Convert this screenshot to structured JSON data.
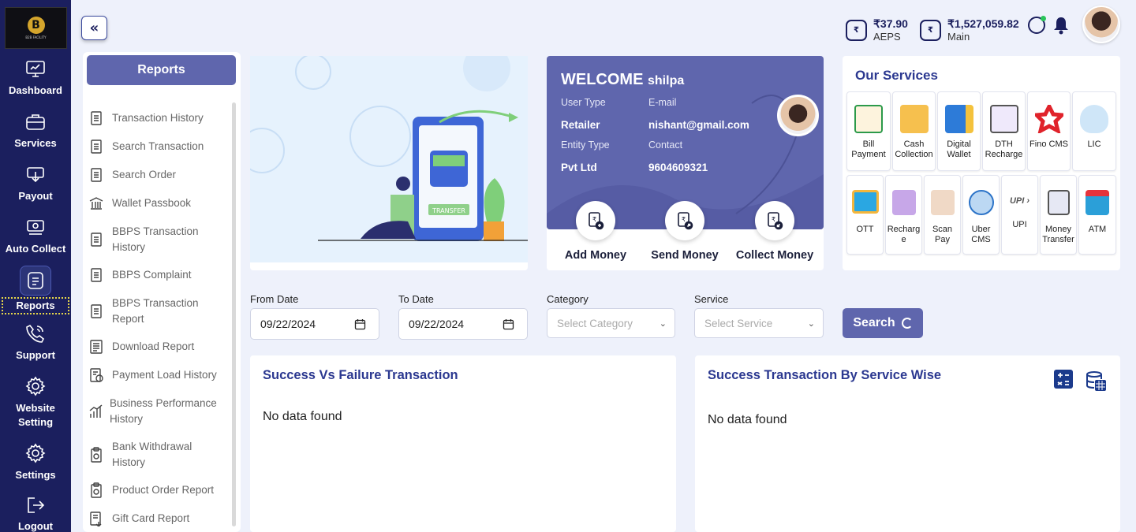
{
  "brand": {
    "logo_text": "B2B FACILITY",
    "logo_letter": "B"
  },
  "nav": [
    {
      "label": "Dashboard",
      "icon": "monitor-icon"
    },
    {
      "label": "Services",
      "icon": "briefcase-icon"
    },
    {
      "label": "Payout",
      "icon": "payout-icon"
    },
    {
      "label": "Auto Collect",
      "icon": "auto-collect-icon"
    },
    {
      "label": "Reports",
      "icon": "report-icon",
      "active": true
    },
    {
      "label": "Support",
      "icon": "phone-icon"
    },
    {
      "label": "Website Setting",
      "icon": "gear-icon"
    },
    {
      "label": "Settings",
      "icon": "gear-icon"
    },
    {
      "label": "Logout",
      "icon": "logout-icon"
    }
  ],
  "header": {
    "collapse_symbol": "«",
    "wallets": [
      {
        "amount": "₹37.90",
        "name": "AEPS"
      },
      {
        "amount": "₹1,527,059.82",
        "name": "Main"
      }
    ]
  },
  "reports": {
    "title": "Reports",
    "items": [
      "Transaction History",
      "Search Transaction",
      "Search Order",
      "Wallet Passbook",
      "BBPS Transaction History",
      "BBPS Complaint",
      "BBPS Transaction Report",
      "Download Report",
      "Payment Load History",
      "Business Performance History",
      "Bank Withdrawal History",
      "Product Order Report",
      "Gift Card Report"
    ]
  },
  "banner": {
    "tag": "TRANSFER"
  },
  "welcome": {
    "greeting": "WELCOME",
    "name": "shilpa",
    "user_type_label": "User Type",
    "user_type": "Retailer",
    "email_label": "E-mail",
    "email": "nishant@gmail.com",
    "entity_type_label": "Entity Type",
    "entity_type": "Pvt Ltd",
    "contact_label": "Contact",
    "contact": "9604609321",
    "actions": [
      "Add Money",
      "Send Money",
      "Collect Money"
    ]
  },
  "services": {
    "title": "Our Services",
    "row1": [
      "Bill Payment",
      "Cash Collection",
      "Digital Wallet",
      "DTH Recharge",
      "Fino CMS",
      "LIC"
    ],
    "row2": [
      "OTT",
      "Recharge",
      "Scan Pay",
      "Uber CMS",
      "UPI",
      "Money Transfer",
      "ATM"
    ]
  },
  "filters": {
    "from_label": "From Date",
    "from_value": "09/22/2024",
    "to_label": "To Date",
    "to_value": "09/22/2024",
    "category_label": "Category",
    "category_placeholder": "Select Category",
    "service_label": "Service",
    "service_placeholder": "Select Service",
    "search_label": "Search"
  },
  "panels": {
    "left_title": "Success Vs Failure Transaction",
    "right_title": "Success Transaction By Service Wise",
    "no_data": "No data found"
  },
  "colors": {
    "nav_bg": "#1b1f5e",
    "accent": "#5f66ad",
    "heading": "#2b3890",
    "page_bg": "#eef1fb"
  }
}
